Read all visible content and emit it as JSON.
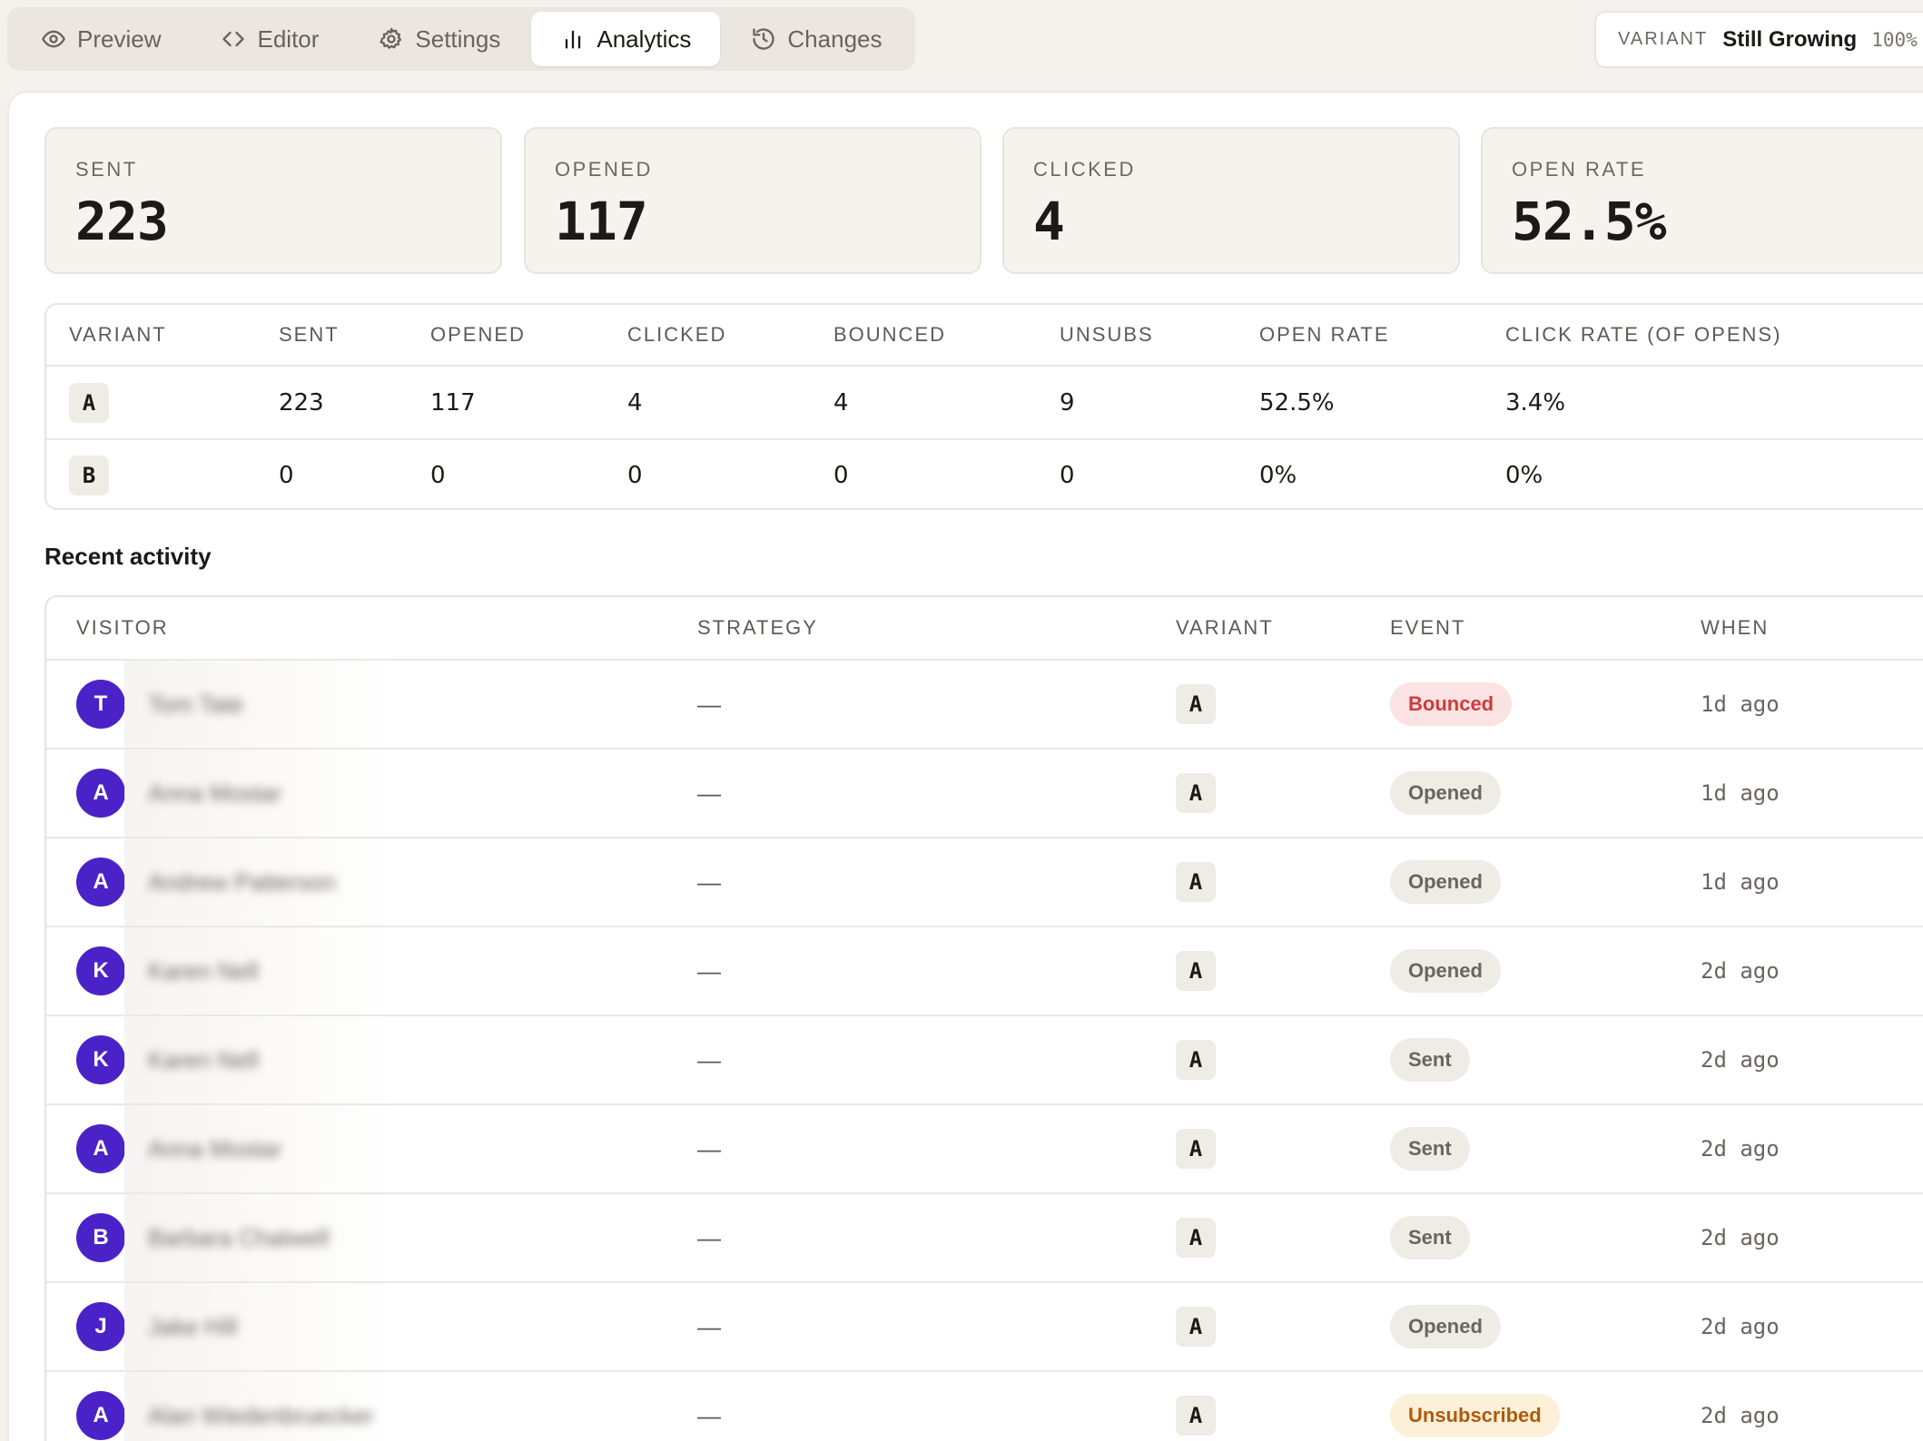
{
  "tabs": [
    {
      "label": "Preview",
      "icon": "eye-icon"
    },
    {
      "label": "Editor",
      "icon": "code-icon"
    },
    {
      "label": "Settings",
      "icon": "gear-icon"
    },
    {
      "label": "Analytics",
      "icon": "bar-chart-icon"
    },
    {
      "label": "Changes",
      "icon": "history-icon"
    }
  ],
  "active_tab": "Analytics",
  "variant_selector": {
    "label": "VARIANT",
    "value": "Still Growing",
    "percent": "100%"
  },
  "stats": [
    {
      "label": "SENT",
      "value": "223"
    },
    {
      "label": "OPENED",
      "value": "117"
    },
    {
      "label": "CLICKED",
      "value": "4"
    },
    {
      "label": "OPEN RATE",
      "value": "52.5%"
    }
  ],
  "variant_table": {
    "columns": [
      "VARIANT",
      "SENT",
      "OPENED",
      "CLICKED",
      "BOUNCED",
      "UNSUBS",
      "OPEN RATE",
      "CLICK RATE (OF OPENS)"
    ],
    "rows": [
      {
        "variant": "A",
        "sent": "223",
        "opened": "117",
        "clicked": "4",
        "bounced": "4",
        "unsubs": "9",
        "open_rate": "52.5%",
        "click_rate": "3.4%"
      },
      {
        "variant": "B",
        "sent": "0",
        "opened": "0",
        "clicked": "0",
        "bounced": "0",
        "unsubs": "0",
        "open_rate": "0%",
        "click_rate": "0%"
      }
    ]
  },
  "recent_activity": {
    "title": "Recent activity",
    "columns": [
      "VISITOR",
      "STRATEGY",
      "VARIANT",
      "EVENT",
      "WHEN"
    ],
    "rows": [
      {
        "initial": "T",
        "name": "Tom Tate",
        "strategy": "—",
        "variant": "A",
        "event": "Bounced",
        "event_type": "bounced",
        "when": "1d ago"
      },
      {
        "initial": "A",
        "name": "Anna Mostar",
        "strategy": "—",
        "variant": "A",
        "event": "Opened",
        "event_type": "opened",
        "when": "1d ago"
      },
      {
        "initial": "A",
        "name": "Andrew Patterson",
        "strategy": "—",
        "variant": "A",
        "event": "Opened",
        "event_type": "opened",
        "when": "1d ago"
      },
      {
        "initial": "K",
        "name": "Karen Nell",
        "strategy": "—",
        "variant": "A",
        "event": "Opened",
        "event_type": "opened",
        "when": "2d ago"
      },
      {
        "initial": "K",
        "name": "Karen Nell",
        "strategy": "—",
        "variant": "A",
        "event": "Sent",
        "event_type": "sent",
        "when": "2d ago"
      },
      {
        "initial": "A",
        "name": "Anna Mostar",
        "strategy": "—",
        "variant": "A",
        "event": "Sent",
        "event_type": "sent",
        "when": "2d ago"
      },
      {
        "initial": "B",
        "name": "Barbara Chatwell",
        "strategy": "—",
        "variant": "A",
        "event": "Sent",
        "event_type": "sent",
        "when": "2d ago"
      },
      {
        "initial": "J",
        "name": "Jake Hill",
        "strategy": "—",
        "variant": "A",
        "event": "Opened",
        "event_type": "opened",
        "when": "2d ago"
      },
      {
        "initial": "A",
        "name": "Alan Wiedenbruecker",
        "strategy": "—",
        "variant": "A",
        "event": "Unsubscribed",
        "event_type": "unsubscribed",
        "when": "2d ago"
      }
    ]
  },
  "colors": {
    "avatar": "#4a22c8",
    "bounced": "#d03a3a",
    "unsubscribed": "#b05a0c",
    "background": "#f5f2ed"
  }
}
